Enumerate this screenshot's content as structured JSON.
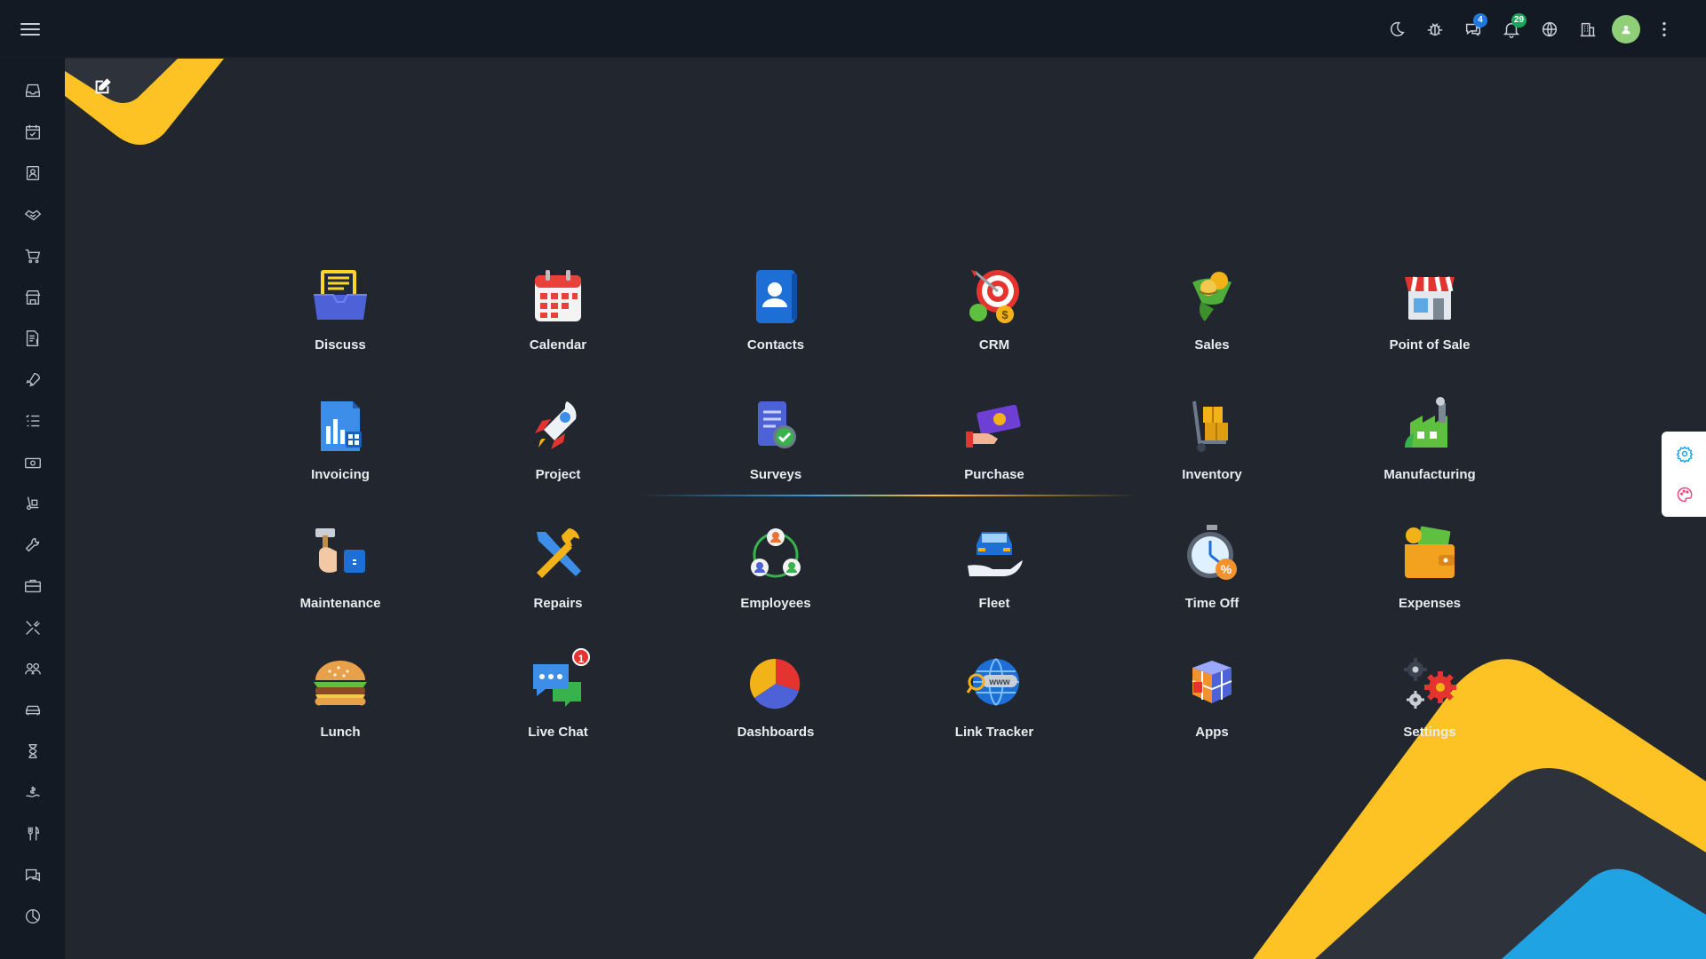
{
  "colors": {
    "background": "#21262f",
    "topbar": "#141a24",
    "accent_yellow": "#fdc324",
    "accent_blue": "#1fa3e3",
    "text": "#e9ecef",
    "badge_blue": "#1f7ae0",
    "badge_green": "#1ba55b"
  },
  "topbar": {
    "menu_icon": "hamburger-icon",
    "icons": [
      {
        "name": "dark-mode-icon"
      },
      {
        "name": "bug-icon"
      },
      {
        "name": "messages-icon",
        "badge": "4"
      },
      {
        "name": "notifications-icon",
        "badge": "29"
      },
      {
        "name": "language-icon"
      },
      {
        "name": "company-icon"
      },
      {
        "name": "user-avatar"
      },
      {
        "name": "more-options-icon"
      }
    ]
  },
  "sidebar": {
    "items": [
      "discuss-inbox-icon",
      "calendar-icon",
      "contacts-icon",
      "crm-handshake-icon",
      "sales-cart-icon",
      "point-of-sale-store-icon",
      "invoicing-icon",
      "project-rocket-icon",
      "surveys-list-icon",
      "purchase-money-icon",
      "inventory-icon",
      "maintenance-wrench-icon",
      "briefcase-icon",
      "repairs-tools-icon",
      "employees-icon",
      "fleet-car-icon",
      "time-off-hourglass-icon",
      "expenses-icon",
      "lunch-icon",
      "live-chat-icon",
      "dashboards-pie-icon"
    ]
  },
  "apps": [
    {
      "label": "Discuss",
      "icon": "discuss-icon"
    },
    {
      "label": "Calendar",
      "icon": "calendar-icon"
    },
    {
      "label": "Contacts",
      "icon": "contacts-icon"
    },
    {
      "label": "CRM",
      "icon": "crm-target-icon"
    },
    {
      "label": "Sales",
      "icon": "sales-icon"
    },
    {
      "label": "Point of Sale",
      "icon": "point-of-sale-icon"
    },
    {
      "label": "Invoicing",
      "icon": "invoicing-icon"
    },
    {
      "label": "Project",
      "icon": "project-rocket-icon"
    },
    {
      "label": "Surveys",
      "icon": "surveys-icon"
    },
    {
      "label": "Purchase",
      "icon": "purchase-icon"
    },
    {
      "label": "Inventory",
      "icon": "inventory-icon"
    },
    {
      "label": "Manufacturing",
      "icon": "manufacturing-icon"
    },
    {
      "label": "Maintenance",
      "icon": "maintenance-icon"
    },
    {
      "label": "Repairs",
      "icon": "repairs-icon"
    },
    {
      "label": "Employees",
      "icon": "employees-icon"
    },
    {
      "label": "Fleet",
      "icon": "fleet-icon"
    },
    {
      "label": "Time Off",
      "icon": "time-off-icon"
    },
    {
      "label": "Expenses",
      "icon": "expenses-icon"
    },
    {
      "label": "Lunch",
      "icon": "lunch-icon"
    },
    {
      "label": "Live Chat",
      "icon": "live-chat-icon",
      "badge": "1"
    },
    {
      "label": "Dashboards",
      "icon": "dashboards-icon"
    },
    {
      "label": "Link Tracker",
      "icon": "link-tracker-icon"
    },
    {
      "label": "Apps",
      "icon": "apps-icon"
    },
    {
      "label": "Settings",
      "icon": "settings-icon"
    }
  ],
  "floating_panel": {
    "buttons": [
      "settings-gear-icon",
      "theme-palette-icon"
    ]
  }
}
